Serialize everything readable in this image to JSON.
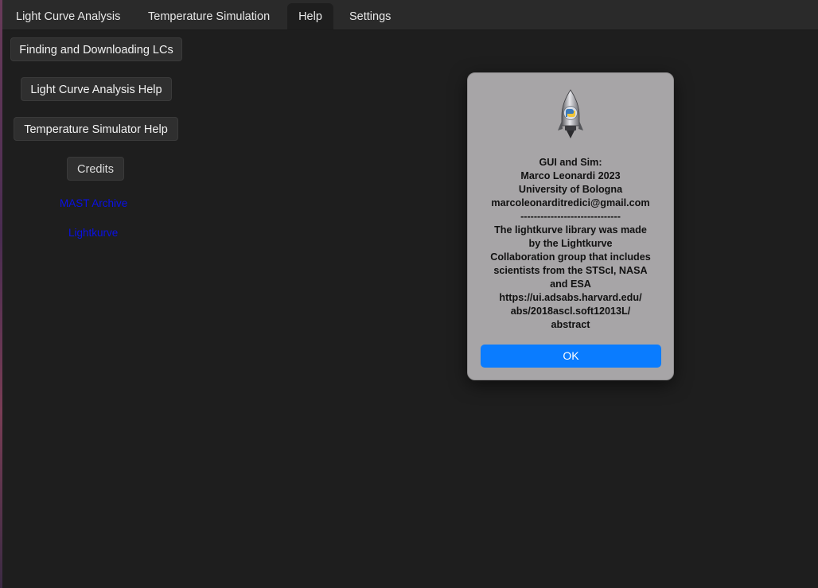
{
  "tabs": [
    {
      "label": "Light Curve Analysis",
      "active": false
    },
    {
      "label": "Temperature Simulation",
      "active": false
    },
    {
      "label": "Help",
      "active": true
    },
    {
      "label": "Settings",
      "active": false
    }
  ],
  "help": {
    "buttons": {
      "finding": "Finding and Downloading LCs",
      "lca_help": "Light Curve Analysis Help",
      "temp_help": "Temperature Simulator Help",
      "credits": "Credits"
    },
    "links": {
      "mast": "MAST Archive",
      "lightkurve": "Lightkurve"
    }
  },
  "dialog": {
    "icon": "python-rocket-icon",
    "lines": [
      "GUI and Sim:",
      "Marco Leonardi 2023",
      "University of Bologna",
      "marcoleonarditredici@gmail.com",
      "------------------------------",
      "The lightkurve library was made",
      "by the Lightkurve",
      "Collaboration group that includes",
      "scientists from the STScI, NASA",
      "and ESA",
      "https://ui.adsabs.harvard.edu/",
      "abs/2018ascl.soft12013L/",
      "abstract"
    ],
    "ok_label": "OK"
  },
  "colors": {
    "background": "#1e1e1e",
    "tabbar": "#2a2a2a",
    "dialog_bg": "#a7a5a7",
    "accent": "#0a7cff",
    "link": "#0a10e6"
  }
}
